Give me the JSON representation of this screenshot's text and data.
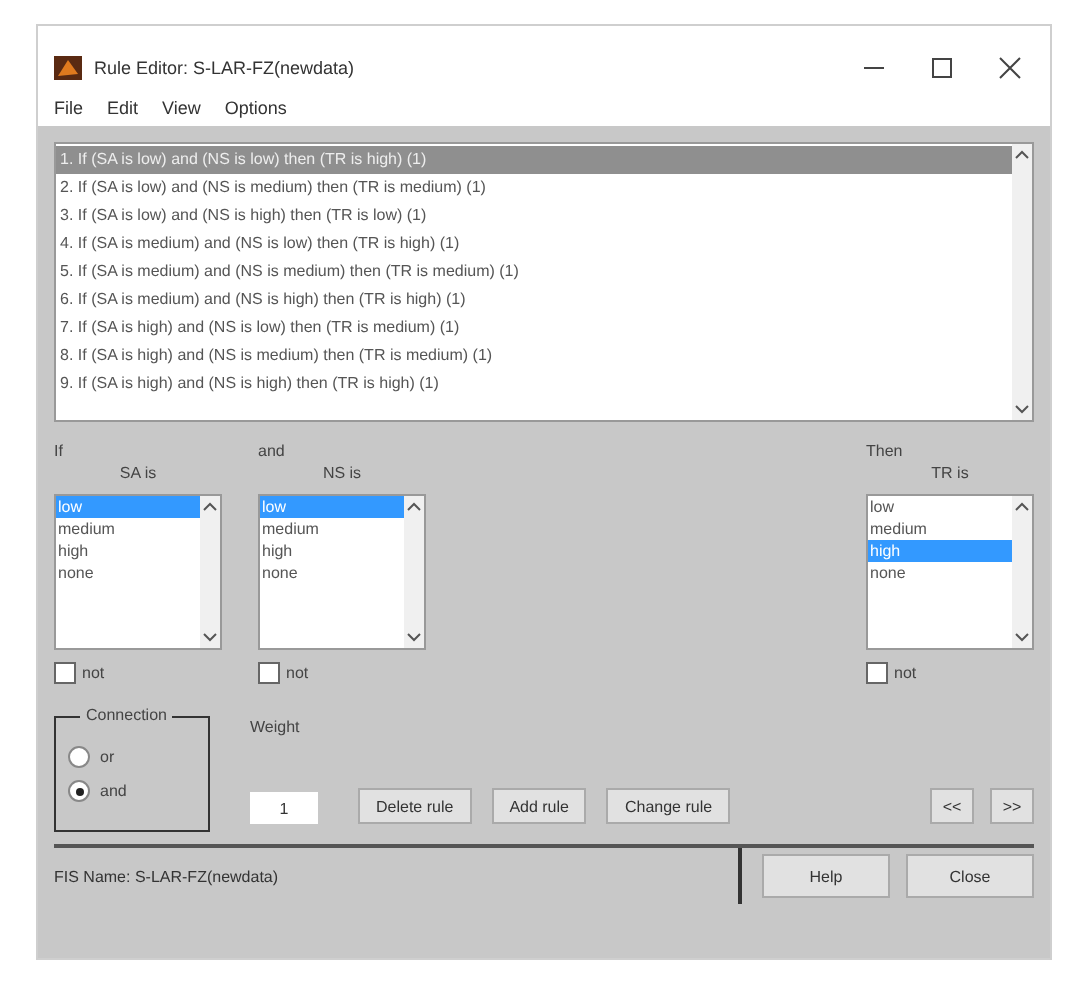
{
  "window": {
    "title": "Rule Editor: S-LAR-FZ(newdata)"
  },
  "menu": [
    "File",
    "Edit",
    "View",
    "Options"
  ],
  "rules": [
    {
      "text": "1. If (SA is low) and (NS is low) then (TR is high) (1)",
      "selected": true
    },
    {
      "text": "2. If (SA is low) and (NS is medium) then (TR is medium) (1)",
      "selected": false
    },
    {
      "text": "3. If (SA is low) and (NS is high) then (TR is low) (1)",
      "selected": false
    },
    {
      "text": "4. If (SA is medium) and (NS is low) then (TR is high) (1)",
      "selected": false
    },
    {
      "text": "5. If (SA is medium) and (NS is medium) then (TR is medium) (1)",
      "selected": false
    },
    {
      "text": "6. If (SA is medium) and (NS is high) then (TR is high) (1)",
      "selected": false
    },
    {
      "text": "7. If (SA is high) and (NS is low) then (TR is medium) (1)",
      "selected": false
    },
    {
      "text": "8. If (SA is high) and (NS is medium) then (TR is medium) (1)",
      "selected": false
    },
    {
      "text": "9. If (SA is high) and (NS is high) then (TR is high) (1)",
      "selected": false
    }
  ],
  "columns": [
    {
      "heading": "If",
      "variable": "SA is",
      "options": [
        {
          "text": "low",
          "selected": true
        },
        {
          "text": "medium",
          "selected": false
        },
        {
          "text": "high",
          "selected": false
        },
        {
          "text": "none",
          "selected": false
        }
      ],
      "negate": {
        "label": "not",
        "checked": false
      }
    },
    {
      "heading": "and",
      "variable": "NS is",
      "options": [
        {
          "text": "low",
          "selected": true
        },
        {
          "text": "medium",
          "selected": false
        },
        {
          "text": "high",
          "selected": false
        },
        {
          "text": "none",
          "selected": false
        }
      ],
      "negate": {
        "label": "not",
        "checked": false
      }
    },
    {
      "heading": "Then",
      "variable": "TR is",
      "options": [
        {
          "text": "low",
          "selected": false
        },
        {
          "text": "medium",
          "selected": false
        },
        {
          "text": "high",
          "selected": true
        },
        {
          "text": "none",
          "selected": false
        }
      ],
      "negate": {
        "label": "not",
        "checked": false
      }
    }
  ],
  "connection": {
    "title": "Connection",
    "options": [
      {
        "label": "or",
        "selected": false
      },
      {
        "label": "and",
        "selected": true
      }
    ]
  },
  "weight": {
    "label": "Weight",
    "value": "1"
  },
  "buttons": [
    "Delete rule",
    "Add rule",
    "Change rule"
  ],
  "nav_buttons": [
    "<<",
    ">>"
  ],
  "status": "FIS Name: S-LAR-FZ(newdata)",
  "footer_buttons": [
    "Help",
    "Close"
  ]
}
